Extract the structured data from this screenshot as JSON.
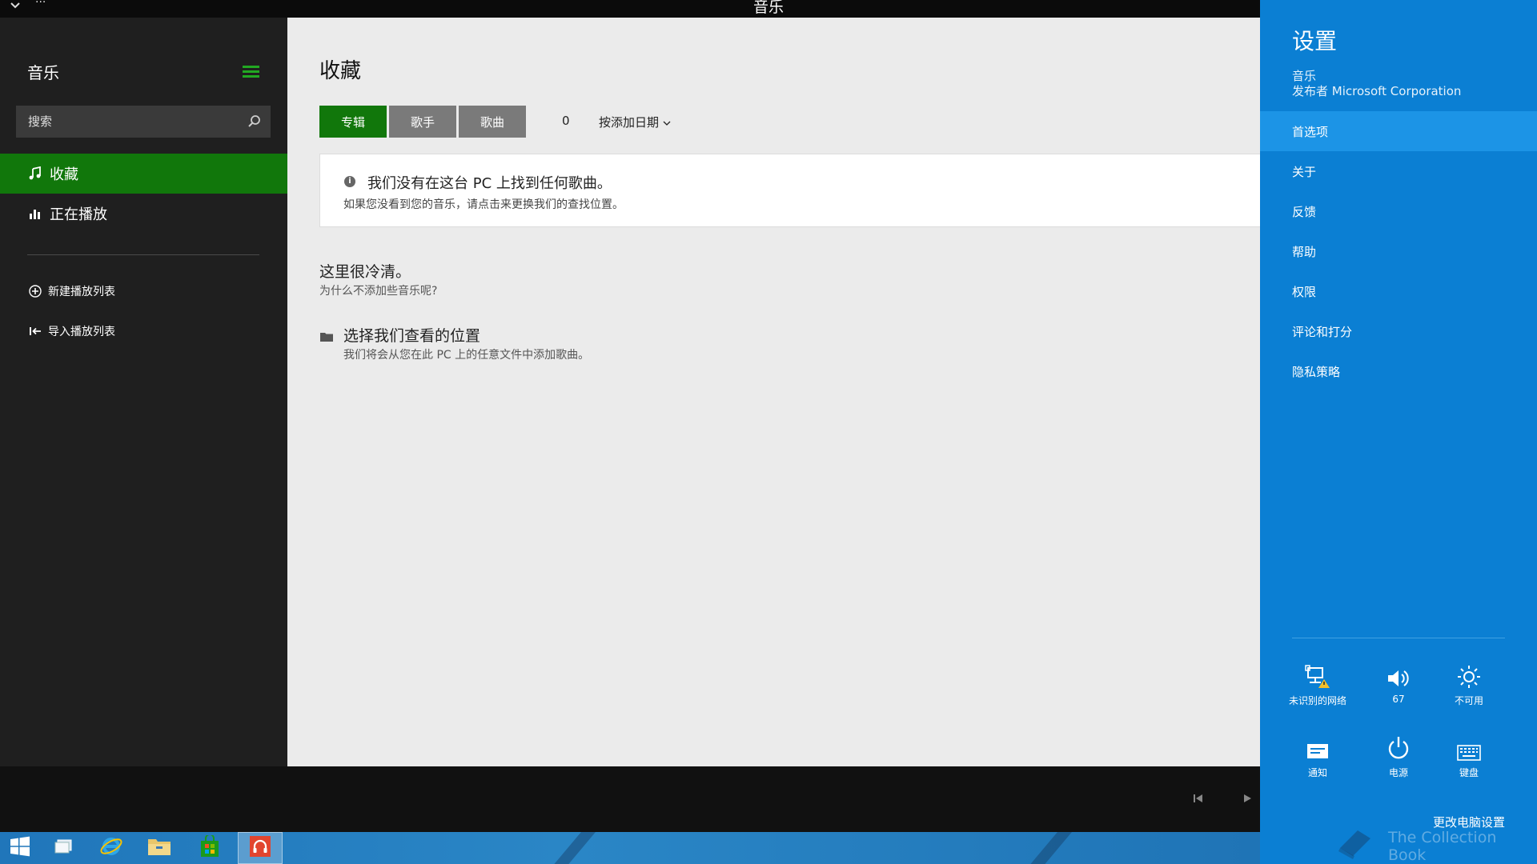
{
  "window": {
    "title": "音乐"
  },
  "nav": {
    "app_title": "音乐",
    "search_placeholder": "搜索",
    "items": [
      {
        "label": "收藏",
        "icon": "music-note-icon",
        "active": true
      },
      {
        "label": "正在播放",
        "icon": "equalizer-icon",
        "active": false
      }
    ],
    "actions": [
      {
        "label": "新建播放列表",
        "icon": "add-circle-icon"
      },
      {
        "label": "导入播放列表",
        "icon": "import-icon"
      }
    ]
  },
  "main": {
    "title": "收藏",
    "tabs": [
      {
        "label": "专辑",
        "active": true
      },
      {
        "label": "歌手",
        "active": false
      },
      {
        "label": "歌曲",
        "active": false
      }
    ],
    "count": "0",
    "sort_label": "按添加日期",
    "notice": {
      "title": "我们没有在这台 PC 上找到任何歌曲。",
      "subtitle": "如果您没看到您的音乐，请点击来更换我们的查找位置。"
    },
    "empty": {
      "heading": "这里很冷清。",
      "subtext": "为什么不添加些音乐呢?"
    },
    "choose": {
      "heading": "选择我们查看的位置",
      "subtext": "我们将会从您在此 PC 上的任意文件中添加歌曲。"
    }
  },
  "charm": {
    "title": "设置",
    "app_name": "音乐",
    "publisher": "发布者 Microsoft Corporation",
    "items": [
      {
        "label": "首选项",
        "active": true
      },
      {
        "label": "关于",
        "active": false
      },
      {
        "label": "反馈",
        "active": false
      },
      {
        "label": "帮助",
        "active": false
      },
      {
        "label": "权限",
        "active": false
      },
      {
        "label": "评论和打分",
        "active": false
      },
      {
        "label": "隐私策略",
        "active": false
      }
    ],
    "quick_settings": [
      {
        "label": "未识别的网络",
        "icon": "network-warning-icon"
      },
      {
        "label": "67",
        "icon": "volume-icon"
      },
      {
        "label": "不可用",
        "icon": "brightness-icon"
      },
      {
        "label": "通知",
        "icon": "notifications-icon"
      },
      {
        "label": "电源",
        "icon": "power-icon"
      },
      {
        "label": "键盘",
        "icon": "keyboard-icon"
      }
    ],
    "change_pc_settings": "更改电脑设置",
    "watermark": "The Collection Book"
  },
  "colors": {
    "accent_green": "#11770b",
    "charm_blue": "#0b7fd3",
    "nav_bg": "#1f1f1f",
    "main_bg": "#ebebeb"
  }
}
